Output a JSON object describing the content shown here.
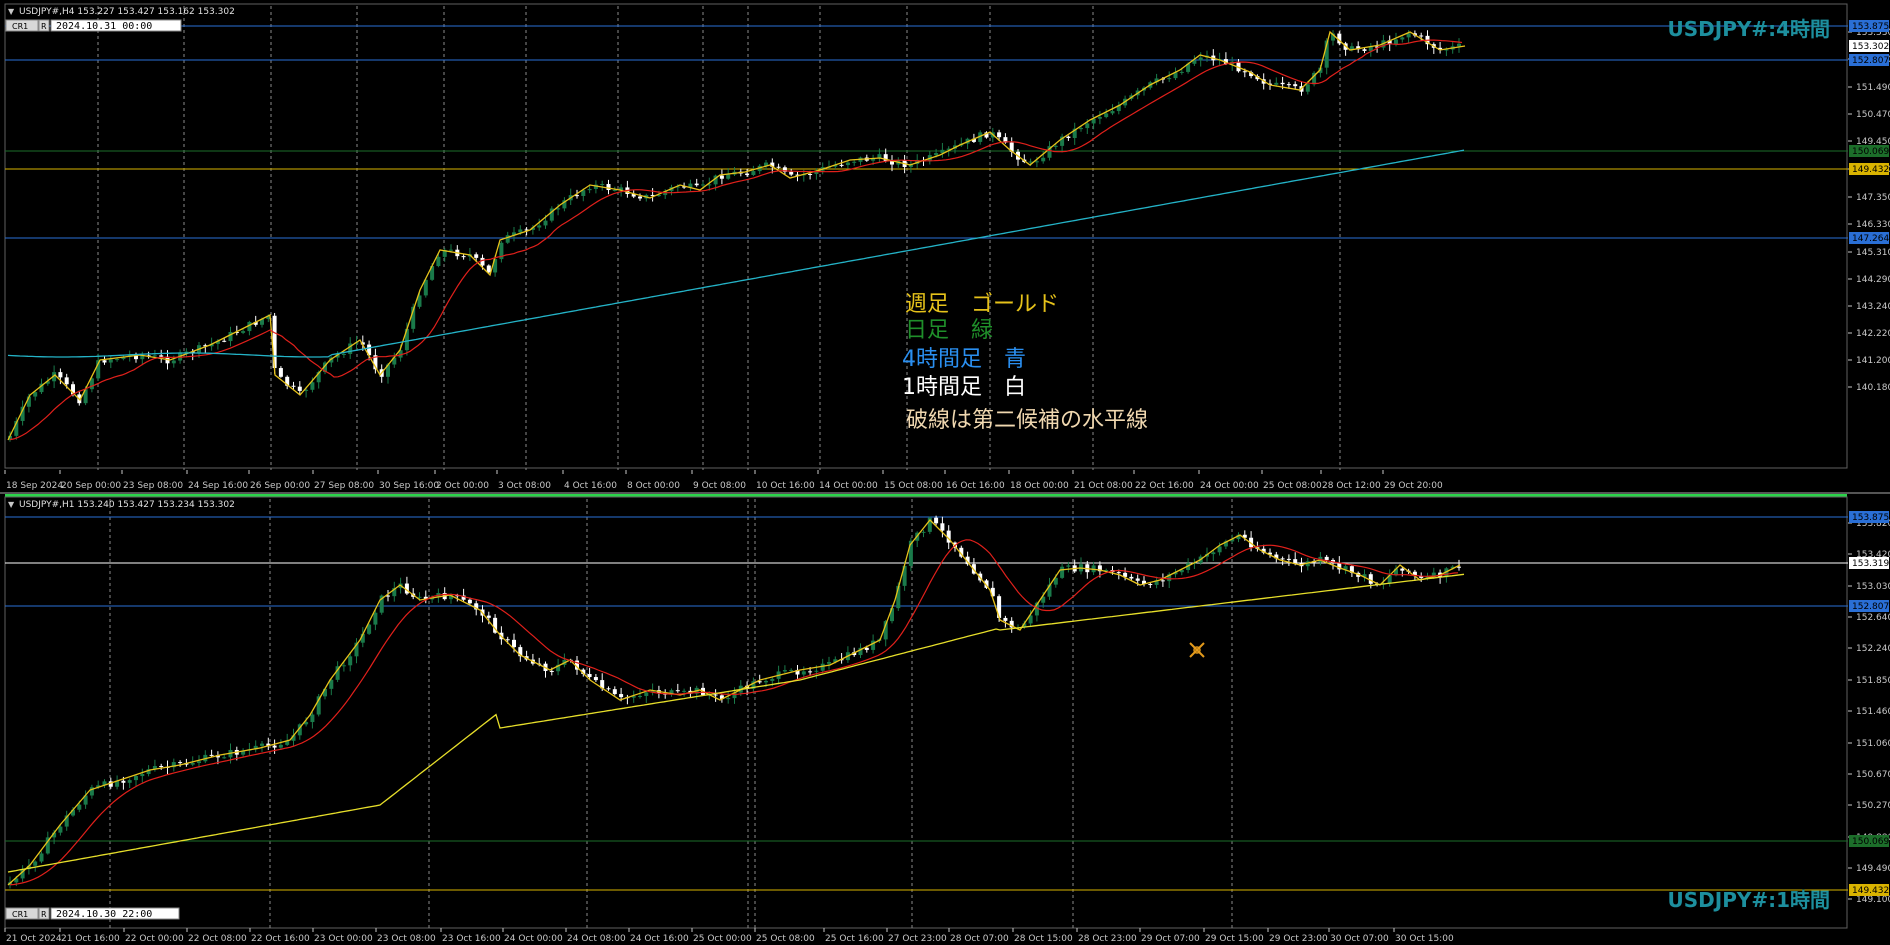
{
  "colors": {
    "bull": "#1a7a4a",
    "bear": "#ffffff",
    "ma_red": "#e0201b",
    "zigzag": "#e6c21a",
    "ma_cyan": "#24b3c7",
    "ma_yellow": "#e6de2a",
    "level_blue": "#2a6fd6",
    "level_green": "#1c6e2a",
    "level_gold": "#d9b300",
    "level_white": "#ffffff",
    "axis_text": "#c8c8c8",
    "title_teal": "#1d8f9e",
    "grid": "#8a8a8a"
  },
  "panels": [
    {
      "id": "h4",
      "header": "USDJPY#,H4  153.227 153.427 153.162 153.302",
      "buttons": [
        "CR1",
        "R"
      ],
      "date_box": "2024.10.31 00:00",
      "watermark": "USDJPY#:4時間",
      "y_ticks": [
        "153.530",
        "152.510",
        "151.490",
        "150.470",
        "149.450",
        "148.400",
        "147.350",
        "146.330",
        "145.310",
        "144.290",
        "143.240",
        "142.220",
        "141.200",
        "140.180"
      ],
      "price_labels": [
        "153.875",
        "153.302",
        "152.807",
        "150.069",
        "149.432",
        "147.264"
      ],
      "x_ticks": [
        "18 Sep 2024",
        "20 Sep 00:00",
        "23 Sep 08:00",
        "24 Sep 16:00",
        "26 Sep 00:00",
        "27 Sep 08:00",
        "30 Sep 16:00",
        "2 Oct 00:00",
        "3 Oct 08:00",
        "4 Oct 16:00",
        "8 Oct 00:00",
        "9 Oct 08:00",
        "10 Oct 16:00",
        "14 Oct 00:00",
        "15 Oct 08:00",
        "16 Oct 16:00",
        "18 Oct 00:00",
        "21 Oct 08:00",
        "22 Oct 16:00",
        "24 Oct 00:00",
        "25 Oct 08:00",
        "28 Oct 12:00",
        "29 Oct 20:00"
      ],
      "legend": [
        {
          "text": "週足　ゴールド",
          "color": "#e6c21a"
        },
        {
          "text": "日足　緑",
          "color": "#1f8f2a"
        },
        {
          "text": "4時間足　青",
          "color": "#2a8ff0"
        },
        {
          "text": "1時間足　白",
          "color": "#ffffff"
        },
        {
          "text": "破線は第二候補の水平線",
          "color": "#f0d8b0"
        }
      ]
    },
    {
      "id": "h1",
      "header": "USDJPY#,H1  153.240 153.427 153.234 153.302",
      "buttons": [
        "CR1",
        "R"
      ],
      "date_box": "2024.10.30 22:00",
      "watermark": "USDJPY#:1時間",
      "y_ticks": [
        "153.820",
        "153.420",
        "153.030",
        "152.640",
        "152.240",
        "151.850",
        "151.460",
        "151.060",
        "150.670",
        "150.270",
        "149.880",
        "149.490",
        "149.100"
      ],
      "price_labels": [
        "153.875",
        "153.319",
        "152.807",
        "150.069",
        "149.432"
      ],
      "x_ticks": [
        "21 Oct 2024",
        "21 Oct 16:00",
        "22 Oct 00:00",
        "22 Oct 08:00",
        "22 Oct 16:00",
        "23 Oct 00:00",
        "23 Oct 08:00",
        "23 Oct 16:00",
        "24 Oct 00:00",
        "24 Oct 08:00",
        "24 Oct 16:00",
        "25 Oct 00:00",
        "25 Oct 08:00",
        "25 Oct 16:00",
        "27 Oct 23:00",
        "28 Oct 07:00",
        "28 Oct 15:00",
        "28 Oct 23:00",
        "29 Oct 07:00",
        "29 Oct 15:00",
        "29 Oct 23:00",
        "30 Oct 07:00",
        "30 Oct 15:00"
      ]
    }
  ]
}
